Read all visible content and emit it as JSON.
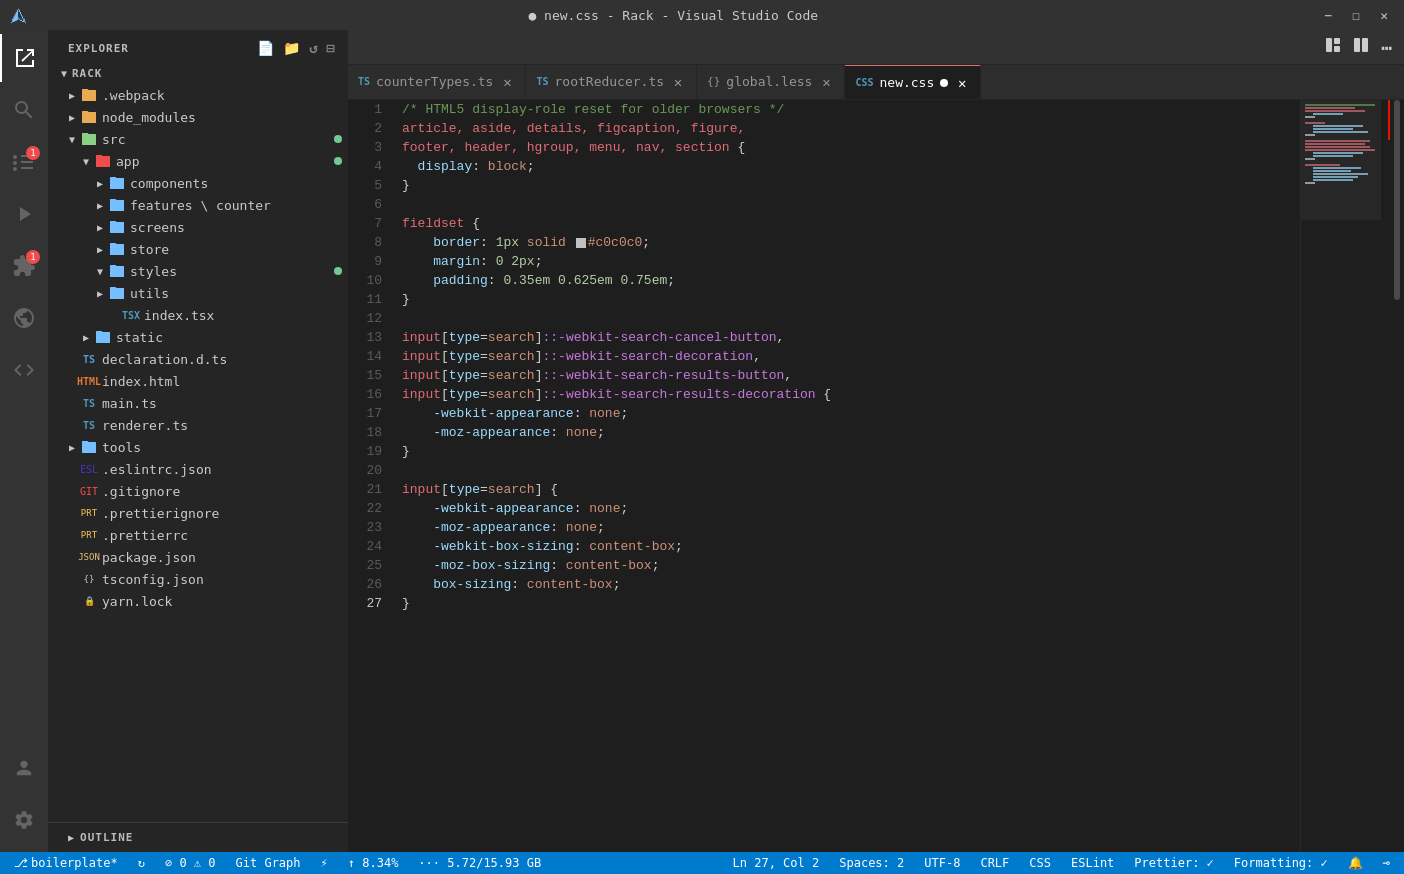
{
  "titleBar": {
    "title": "● new.css - Rack - Visual Studio Code",
    "logo": "⟨/⟩"
  },
  "activityBar": {
    "icons": [
      {
        "name": "explorer-icon",
        "symbol": "⎘",
        "active": true,
        "badge": null
      },
      {
        "name": "search-icon",
        "symbol": "⌕",
        "active": false,
        "badge": null
      },
      {
        "name": "source-control-icon",
        "symbol": "⑂",
        "active": false,
        "badge": "1"
      },
      {
        "name": "debug-icon",
        "symbol": "▷",
        "active": false,
        "badge": null
      },
      {
        "name": "extensions-icon",
        "symbol": "⊞",
        "active": false,
        "badge": "1"
      },
      {
        "name": "remote-icon",
        "symbol": "⊹",
        "active": false,
        "badge": null
      },
      {
        "name": "code-icon",
        "symbol": "</>",
        "active": false,
        "badge": null
      }
    ],
    "bottomIcons": [
      {
        "name": "account-icon",
        "symbol": "👤"
      },
      {
        "name": "settings-icon",
        "symbol": "⚙"
      }
    ]
  },
  "sidebar": {
    "title": "EXPLORER",
    "root": "RACK",
    "tree": [
      {
        "indent": 0,
        "type": "folder",
        "arrow": "▶",
        "icon": "📁",
        "iconClass": "icon-folder",
        "label": ".webpack",
        "dot": false
      },
      {
        "indent": 0,
        "type": "folder",
        "arrow": "▶",
        "icon": "📁",
        "iconClass": "icon-folder",
        "label": "node_modules",
        "dot": false
      },
      {
        "indent": 0,
        "type": "folder-open",
        "arrow": "▼",
        "icon": "📁",
        "iconClass": "icon-folder-src",
        "label": "src",
        "dot": true
      },
      {
        "indent": 1,
        "type": "folder-open",
        "arrow": "▼",
        "icon": "📁",
        "iconClass": "icon-folder-app",
        "label": "app",
        "dot": true
      },
      {
        "indent": 2,
        "type": "folder",
        "arrow": "▶",
        "icon": "📁",
        "iconClass": "icon-folder-blue",
        "label": "components",
        "dot": false
      },
      {
        "indent": 2,
        "type": "folder",
        "arrow": "▶",
        "icon": "📁",
        "iconClass": "icon-folder-blue",
        "label": "features\\counter",
        "dot": false
      },
      {
        "indent": 2,
        "type": "folder",
        "arrow": "▶",
        "icon": "📁",
        "iconClass": "icon-folder-blue",
        "label": "screens",
        "dot": false
      },
      {
        "indent": 2,
        "type": "folder",
        "arrow": "▶",
        "icon": "📁",
        "iconClass": "icon-folder-blue",
        "label": "store",
        "dot": false
      },
      {
        "indent": 2,
        "type": "folder-open",
        "arrow": "▼",
        "icon": "📁",
        "iconClass": "icon-folder-blue",
        "label": "styles",
        "dot": true
      },
      {
        "indent": 2,
        "type": "folder",
        "arrow": "▶",
        "icon": "📁",
        "iconClass": "icon-folder-blue",
        "label": "utils",
        "dot": false
      },
      {
        "indent": 3,
        "type": "file",
        "arrow": "",
        "icon": "tsx",
        "iconClass": "icon-tsx",
        "label": "index.tsx",
        "dot": false
      },
      {
        "indent": 1,
        "type": "folder",
        "arrow": "▶",
        "icon": "📁",
        "iconClass": "icon-folder-blue",
        "label": "static",
        "dot": false
      },
      {
        "indent": 0,
        "type": "file",
        "arrow": "",
        "icon": "ts",
        "iconClass": "icon-ts",
        "label": "declaration.d.ts",
        "dot": false
      },
      {
        "indent": 0,
        "type": "file",
        "arrow": "",
        "icon": "html",
        "iconClass": "icon-html",
        "label": "index.html",
        "dot": false
      },
      {
        "indent": 0,
        "type": "file",
        "arrow": "",
        "icon": "ts",
        "iconClass": "icon-ts",
        "label": "main.ts",
        "dot": false
      },
      {
        "indent": 0,
        "type": "file",
        "arrow": "",
        "icon": "ts",
        "iconClass": "icon-ts",
        "label": "renderer.ts",
        "dot": false
      },
      {
        "indent": 0,
        "type": "folder",
        "arrow": "▶",
        "icon": "📁",
        "iconClass": "icon-folder-blue",
        "label": "tools",
        "dot": false
      },
      {
        "indent": 0,
        "type": "file",
        "arrow": "",
        "icon": "json",
        "iconClass": "icon-eslint",
        "label": ".eslintrc.json",
        "dot": false
      },
      {
        "indent": 0,
        "type": "file",
        "arrow": "",
        "icon": "git",
        "iconClass": "icon-git",
        "label": ".gitignore",
        "dot": false
      },
      {
        "indent": 0,
        "type": "file",
        "arrow": "",
        "icon": "pret",
        "iconClass": "icon-prettier",
        "label": ".prettierignore",
        "dot": false
      },
      {
        "indent": 0,
        "type": "file",
        "arrow": "",
        "icon": "pret",
        "iconClass": "icon-prettier",
        "label": ".prettierrc",
        "dot": false
      },
      {
        "indent": 0,
        "type": "file",
        "arrow": "",
        "icon": "json",
        "iconClass": "icon-json",
        "label": "package.json",
        "dot": false
      },
      {
        "indent": 0,
        "type": "file",
        "arrow": "",
        "icon": "{}",
        "iconClass": "icon-json",
        "label": "tsconfig.json",
        "dot": false
      },
      {
        "indent": 0,
        "type": "file",
        "arrow": "",
        "icon": "yarn",
        "iconClass": "icon-yarn",
        "label": "yarn.lock",
        "dot": false
      }
    ]
  },
  "tabs": [
    {
      "label": "counterTypes.ts",
      "icon": "ts",
      "active": false,
      "modified": false
    },
    {
      "label": "rootReducer.ts",
      "icon": "ts",
      "active": false,
      "modified": false
    },
    {
      "label": "global.less",
      "icon": "{}",
      "active": false,
      "modified": false
    },
    {
      "label": "new.css",
      "icon": "css",
      "active": true,
      "modified": true
    }
  ],
  "statusBar": {
    "left": [
      {
        "name": "branch-status",
        "text": "⎇  boilerplate*"
      },
      {
        "name": "sync-status",
        "text": "↻"
      },
      {
        "name": "errors-status",
        "text": "⊘ 0  ⚠ 0"
      },
      {
        "name": "git-graph-status",
        "text": "Git Graph"
      },
      {
        "name": "lightning-status",
        "text": "⚡"
      },
      {
        "name": "git-percent",
        "text": "↑ 8.34%"
      },
      {
        "name": "memory-status",
        "text": "··· 5.72/15.93 GB"
      }
    ],
    "right": [
      {
        "name": "cursor-position",
        "text": "Ln 27, Col 2"
      },
      {
        "name": "spaces",
        "text": "Spaces: 2"
      },
      {
        "name": "encoding",
        "text": "UTF-8"
      },
      {
        "name": "line-ending",
        "text": "CRLF"
      },
      {
        "name": "language",
        "text": "CSS"
      },
      {
        "name": "eslint",
        "text": "ESLint"
      },
      {
        "name": "prettier",
        "text": "Prettier: ✓"
      },
      {
        "name": "formatting",
        "text": "Formatting: ✓"
      },
      {
        "name": "bell-icon",
        "text": "🔔"
      },
      {
        "name": "broadcast-icon",
        "text": "⊸"
      }
    ]
  },
  "codeLines": [
    {
      "num": 1,
      "content": "comment",
      "text": "/* HTML5 display-role reset for older browsers */"
    },
    {
      "num": 2,
      "content": "tags",
      "text": "article, aside, details, figcaption, figure,"
    },
    {
      "num": 3,
      "content": "tags",
      "text": "footer, header, hgroup, menu, nav, section {"
    },
    {
      "num": 4,
      "content": "prop-val",
      "prop": "  display",
      "val": " block",
      "semi": ";"
    },
    {
      "num": 5,
      "content": "close",
      "text": "}"
    },
    {
      "num": 6,
      "content": "empty",
      "text": ""
    },
    {
      "num": 7,
      "content": "selector",
      "text": "fieldset {"
    },
    {
      "num": 8,
      "content": "border",
      "prop": "    border",
      "val1": " 1px solid",
      "swatch": "#c0c0c0",
      "val2": "#c0c0c0",
      "semi": ";"
    },
    {
      "num": 9,
      "content": "prop-val",
      "prop": "    margin",
      "val": " 0 2px",
      "semi": ";"
    },
    {
      "num": 10,
      "content": "prop-val",
      "prop": "    padding",
      "val": " 0.35em 0.625em 0.75em",
      "semi": ";"
    },
    {
      "num": 11,
      "content": "close",
      "text": "}"
    },
    {
      "num": 12,
      "content": "empty",
      "text": ""
    },
    {
      "num": 13,
      "content": "input-sel",
      "text": "input[type=search]::-webkit-search-cancel-button,"
    },
    {
      "num": 14,
      "content": "input-sel",
      "text": "input[type=search]::-webkit-search-decoration,"
    },
    {
      "num": 15,
      "content": "input-sel",
      "text": "input[type=search]::-webkit-search-results-button,"
    },
    {
      "num": 16,
      "content": "input-sel-open",
      "text": "input[type=search]::-webkit-search-results-decoration {"
    },
    {
      "num": 17,
      "content": "prop-val",
      "prop": "    -webkit-appearance",
      "val": " none",
      "semi": ";"
    },
    {
      "num": 18,
      "content": "prop-val",
      "prop": "    -moz-appearance",
      "val": " none",
      "semi": ";"
    },
    {
      "num": 19,
      "content": "close",
      "text": "}"
    },
    {
      "num": 20,
      "content": "empty",
      "text": ""
    },
    {
      "num": 21,
      "content": "selector-open",
      "text": "input[type=search] {"
    },
    {
      "num": 22,
      "content": "prop-val",
      "prop": "    -webkit-appearance",
      "val": " none",
      "semi": ";"
    },
    {
      "num": 23,
      "content": "prop-val",
      "prop": "    -moz-appearance",
      "val": " none",
      "semi": ";"
    },
    {
      "num": 24,
      "content": "prop-val",
      "prop": "    -webkit-box-sizing",
      "val": " content-box",
      "semi": ";"
    },
    {
      "num": 25,
      "content": "prop-val",
      "prop": "    -moz-box-sizing",
      "val": " content-box",
      "semi": ";"
    },
    {
      "num": 26,
      "content": "prop-val",
      "prop": "    box-sizing",
      "val": " content-box",
      "semi": ";"
    },
    {
      "num": 27,
      "content": "close",
      "text": "}"
    }
  ]
}
